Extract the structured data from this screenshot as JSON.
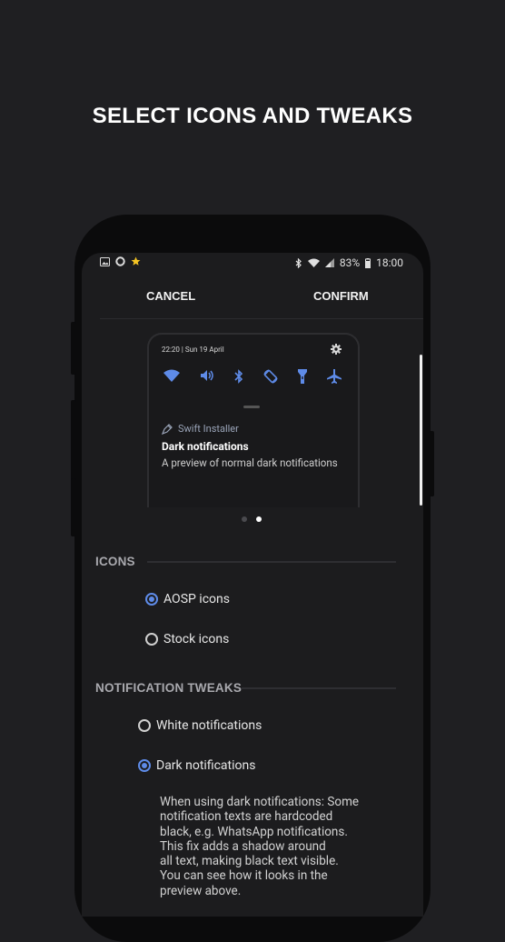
{
  "headline": "SELECT ICONS AND TWEAKS",
  "status_bar": {
    "battery": "83%",
    "time": "18:00"
  },
  "actions": {
    "cancel": "CANCEL",
    "confirm": "CONFIRM"
  },
  "preview": {
    "time_date": "22:20 | Sun 19 April",
    "app_name": "Swift Installer",
    "title": "Dark notifications",
    "text": "A preview of normal dark notifications",
    "quick_settings": [
      "wifi-icon",
      "volume-icon",
      "bluetooth-icon",
      "auto-rotate-icon",
      "flashlight-icon",
      "airplane-icon"
    ]
  },
  "pager": {
    "count": 2,
    "active": 2
  },
  "icons_section": {
    "heading": "ICONS",
    "options": [
      {
        "label": "AOSP icons",
        "selected": true
      },
      {
        "label": "Stock icons",
        "selected": false
      }
    ]
  },
  "tweaks_section": {
    "heading": "NOTIFICATION TWEAKS",
    "options": [
      {
        "label": "White notifications",
        "selected": false
      },
      {
        "label": "Dark notifications",
        "selected": true
      }
    ],
    "description": [
      "When using dark notifications: Some",
      "notification texts are hardcoded",
      "black, e.g. WhatsApp notifications.",
      "This fix adds a shadow around",
      "all text, making black text visible.",
      "You can see how it looks in the",
      "preview above."
    ]
  },
  "colors": {
    "accent": "#5e8be8",
    "background": "#1f1f22",
    "screen": "#1c1c1e"
  }
}
